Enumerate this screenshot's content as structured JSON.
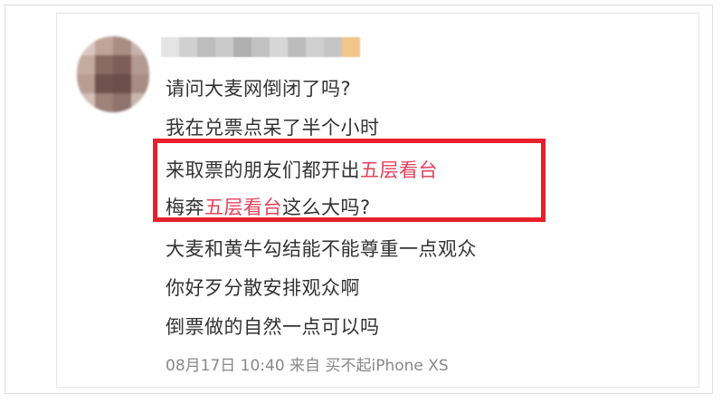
{
  "post": {
    "lines": [
      "请问大麦网倒闭了吗?",
      "我在兑票点呆了半个小时"
    ],
    "highlighted": {
      "line1_prefix": "来取票的朋友们都开出",
      "line1_red": "五层看台",
      "line2_prefix": "梅奔",
      "line2_red": "五层看台",
      "line2_suffix": "这么大吗?"
    },
    "rest_lines": [
      "大麦和黄牛勾结能不能尊重一点观众",
      "你好歹分散安排观众啊",
      "倒票做的自然一点可以吗"
    ],
    "meta": "08月17日 10:40  来自 买不起iPhone XS"
  },
  "colors": {
    "highlight_border": "#e8202c",
    "link_red": "#e3425b",
    "text": "#333333",
    "meta": "#888888"
  },
  "avatar_pixels": [
    "#d9c7c0",
    "#bfa49b",
    "#a98c83",
    "#c7b3ac",
    "#c4aba2",
    "#8a6a62",
    "#7d5e58",
    "#b39a92",
    "#b89d95",
    "#6e524e",
    "#6b4f4a",
    "#a88d86",
    "#d3bfb8",
    "#9f827a",
    "#8f736c",
    "#cbb7b0"
  ],
  "username_pixels": [
    "#e4e4e4",
    "#d0d0d0",
    "#bdbdbd",
    "#c9c9c9",
    "#b0b0b0",
    "#c2c2c2",
    "#d6d6d6",
    "#bcbcbc",
    "#cfcfcf",
    "#c5c5c5",
    "#f2c68a"
  ]
}
